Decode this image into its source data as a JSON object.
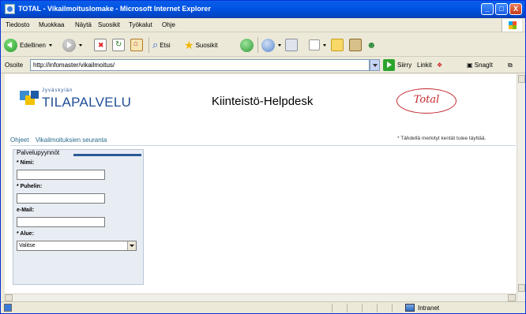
{
  "window": {
    "title": "TOTAL - Vikailmoituslomake - Microsoft Internet Explorer",
    "buttons": [
      "_",
      "□",
      "X"
    ]
  },
  "menubar": {
    "items": [
      "Tiedosto",
      "Muokkaa",
      "Näytä",
      "Suosikit",
      "Työkalut",
      "Ohje"
    ]
  },
  "toolbar": {
    "back_label": "Edellinen",
    "search_label": "Etsi",
    "favorites_label": "Suosikit"
  },
  "addressbar": {
    "label": "Osoite",
    "url": "http://infomaster/vikailmoitus/",
    "go_label": "Siirry",
    "links_label": "Linkit",
    "snagit_label": "SnagIt"
  },
  "page": {
    "logo_small": "Jyväskylän",
    "logo_big": "TILAPALVELU",
    "header_title": "Kiinteistö-Helpdesk",
    "total_logo": "Total",
    "nav_links": [
      "Ohjeet",
      "Vikailmoituksien seuranta"
    ],
    "required_note": "* Tähdellä merkityt kentät tulee täyttää.",
    "panel_title": "Palvelupyynnöt",
    "form": {
      "name_label": "* Nimi:",
      "phone_label": "* Puhelin:",
      "email_label": "e-Mail:",
      "area_label": "* Alue:",
      "area_selected": "Valitse",
      "name_value": "",
      "phone_value": "",
      "email_value": ""
    }
  },
  "statusbar": {
    "zone_label": "Intranet"
  }
}
